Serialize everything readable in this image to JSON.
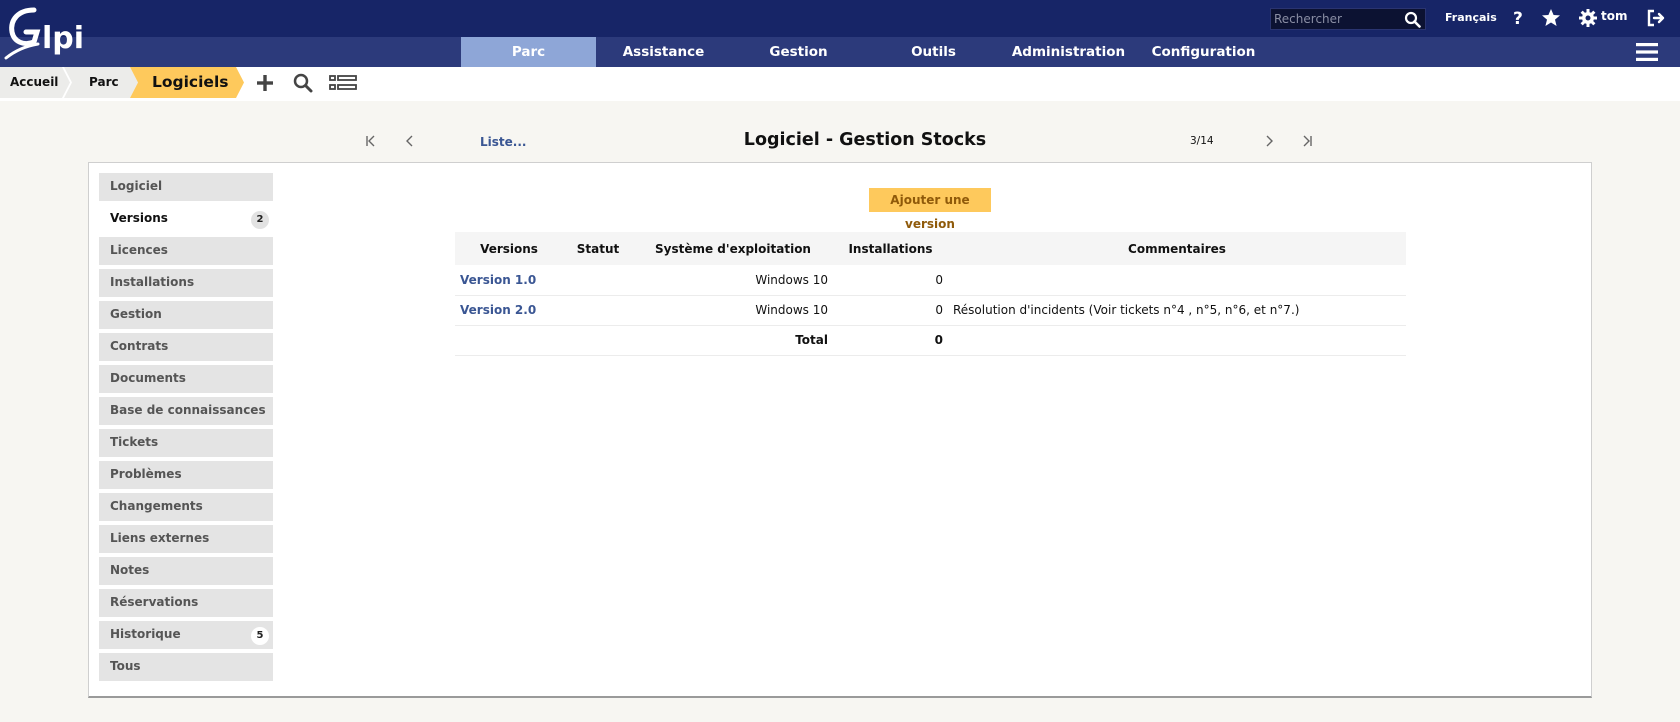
{
  "header": {
    "logo_alt": "glpi",
    "search_placeholder": "Rechercher",
    "language": "Français",
    "user": "tom",
    "icons": [
      "search-icon",
      "help-icon",
      "star-icon",
      "gear-icon",
      "logout-icon"
    ]
  },
  "nav": {
    "items": [
      {
        "label": "Parc",
        "active": true
      },
      {
        "label": "Assistance",
        "active": false
      },
      {
        "label": "Gestion",
        "active": false
      },
      {
        "label": "Outils",
        "active": false
      },
      {
        "label": "Administration",
        "active": false
      },
      {
        "label": "Configuration",
        "active": false
      }
    ]
  },
  "breadcrumb": {
    "home": "Accueil",
    "section": "Parc",
    "current": "Logiciels"
  },
  "pager": {
    "list_link": "Liste...",
    "title": "Logiciel - Gestion Stocks",
    "position": "3/14"
  },
  "tabs": [
    {
      "label": "Logiciel"
    },
    {
      "label": "Versions",
      "badge": "2",
      "active": true
    },
    {
      "label": "Licences"
    },
    {
      "label": "Installations"
    },
    {
      "label": "Gestion"
    },
    {
      "label": "Contrats"
    },
    {
      "label": "Documents"
    },
    {
      "label": "Base de connaissances"
    },
    {
      "label": "Tickets"
    },
    {
      "label": "Problèmes"
    },
    {
      "label": "Changements"
    },
    {
      "label": "Liens externes"
    },
    {
      "label": "Notes"
    },
    {
      "label": "Réservations"
    },
    {
      "label": "Historique",
      "badge": "5"
    },
    {
      "label": "Tous"
    }
  ],
  "content": {
    "add_button": "Ajouter une version",
    "columns": [
      "Versions",
      "Statut",
      "Système d'exploitation",
      "Installations",
      "Commentaires"
    ],
    "rows": [
      {
        "version": "Version 1.0",
        "status": "",
        "os": "Windows 10",
        "installations": "0",
        "comment": ""
      },
      {
        "version": "Version 2.0",
        "status": "",
        "os": "Windows 10",
        "installations": "0",
        "comment": "Résolution d'incidents (Voir tickets n°4 , n°5, n°6, et n°7.)"
      }
    ],
    "total_label": "Total",
    "total_value": "0"
  },
  "colors": {
    "header_dark": "#172567",
    "nav": "#2c3a7b",
    "nav_active": "#8ea6d7",
    "accent": "#fec95c",
    "link": "#3a5693"
  }
}
